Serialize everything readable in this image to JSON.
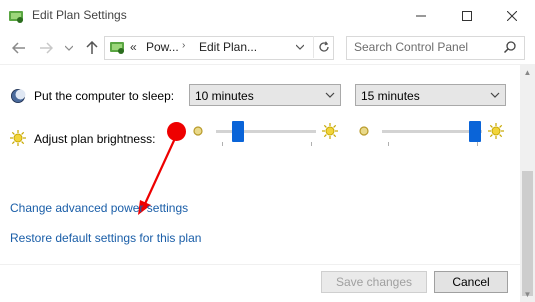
{
  "window": {
    "title": "Edit Plan Settings",
    "icons": {
      "app": "power-options-icon",
      "minimize": "minimize-icon",
      "maximize": "maximize-icon",
      "close": "close-icon"
    }
  },
  "address": {
    "breadcrumb_prefix": "«",
    "crumbs": [
      "Pow...",
      "Edit Plan..."
    ],
    "search_placeholder": "Search Control Panel"
  },
  "settings": {
    "sleep": {
      "label": "Put the computer to sleep:",
      "battery_value": "10 minutes",
      "plugged_value": "15 minutes"
    },
    "brightness": {
      "label": "Adjust plan brightness:",
      "battery_level": 0.22,
      "plugged_level": 0.93
    }
  },
  "links": {
    "advanced": "Change advanced power settings",
    "restore": "Restore default settings for this plan"
  },
  "buttons": {
    "save": "Save changes",
    "cancel": "Cancel"
  },
  "colors": {
    "link": "#1a5ea8",
    "slider_thumb": "#0a64d8",
    "annotation": "#ee0000"
  }
}
